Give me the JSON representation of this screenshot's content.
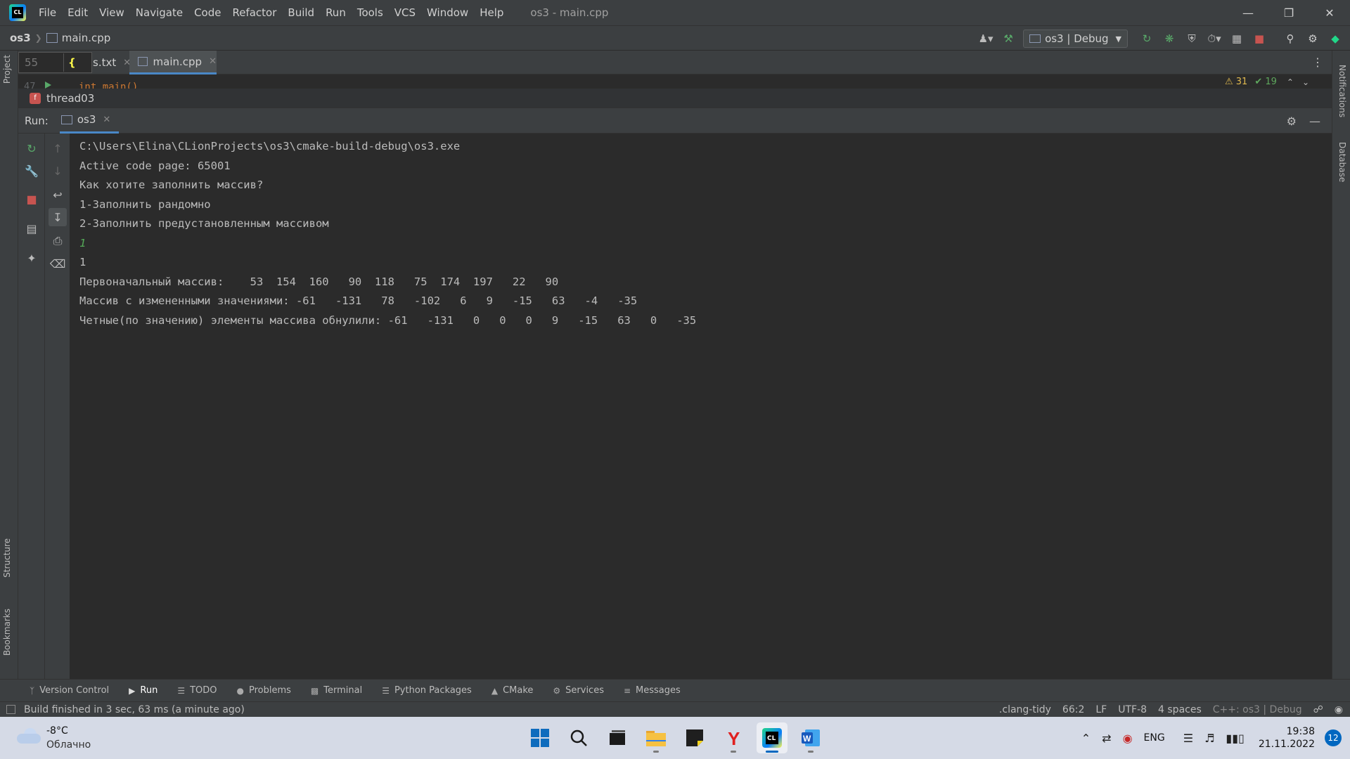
{
  "titlebar": {
    "menu": [
      "File",
      "Edit",
      "View",
      "Navigate",
      "Code",
      "Refactor",
      "Build",
      "Run",
      "Tools",
      "VCS",
      "Window",
      "Help"
    ],
    "title": "os3 - main.cpp",
    "logo_text": "CL"
  },
  "navbar": {
    "project": "os3",
    "file": "main.cpp",
    "run_config": "os3 | Debug"
  },
  "editor": {
    "goto_line_value": "55",
    "tabs": [
      {
        "label": "s.txt"
      },
      {
        "label": "main.cpp",
        "active": true
      }
    ],
    "visible_code_line_number": "47",
    "visible_code": "int main()",
    "warnings": "31",
    "weak_warnings": "19",
    "breadcrumb_function": "thread03"
  },
  "run_window": {
    "label": "Run:",
    "tab": "os3",
    "console_lines": [
      {
        "text": "C:\\Users\\Elina\\CLionProjects\\os3\\cmake-build-debug\\os3.exe",
        "input": false
      },
      {
        "text": "Active code page: 65001",
        "input": false
      },
      {
        "text": "Как хотите заполнить массив?",
        "input": false
      },
      {
        "text": "1-Заполнить рандомно",
        "input": false
      },
      {
        "text": "2-Заполнить предустановленным массивом",
        "input": false
      },
      {
        "text": "1",
        "input": true
      },
      {
        "text": "1",
        "input": false
      },
      {
        "text": "Первоначальный массив:    53  154  160   90  118   75  174  197   22   90",
        "input": false
      },
      {
        "text": "Массив с измененными значениями: -61   -131   78   -102   6   9   -15   63   -4   -35",
        "input": false
      },
      {
        "text": "Четные(по значению) элементы массива обнулили: -61   -131   0   0   0   9   -15   63   0   -35",
        "input": false
      }
    ]
  },
  "side_panels": {
    "left_top": "Project",
    "left_structure": "Structure",
    "left_bookmarks": "Bookmarks",
    "right_notifications": "Notifications",
    "right_database": "Database"
  },
  "bottom_tabs": [
    {
      "label": "Version Control",
      "icon": "branch-icon"
    },
    {
      "label": "Run",
      "icon": "play-icon",
      "active": true
    },
    {
      "label": "TODO",
      "icon": "list-icon"
    },
    {
      "label": "Problems",
      "icon": "info-icon"
    },
    {
      "label": "Terminal",
      "icon": "terminal-icon"
    },
    {
      "label": "Python Packages",
      "icon": "layers-icon"
    },
    {
      "label": "CMake",
      "icon": "triangle-icon"
    },
    {
      "label": "Services",
      "icon": "services-icon"
    },
    {
      "label": "Messages",
      "icon": "messages-icon"
    }
  ],
  "statusbar": {
    "message": "Build finished in 3 sec, 63 ms (a minute ago)",
    "clang_tidy": ".clang-tidy",
    "position": "66:2",
    "line_sep": "LF",
    "encoding": "UTF-8",
    "indent": "4 spaces",
    "context": "C++: os3 | Debug"
  },
  "taskbar": {
    "temperature": "-8°C",
    "weather": "Облачно",
    "language": "ENG",
    "time": "19:38",
    "date": "21.11.2022",
    "notifications": "12"
  },
  "colors": {
    "background": "#2b2b2b",
    "panel": "#3c3f41",
    "accent": "#4a88c7",
    "console_text": "#bbbbbb",
    "console_input": "#54a857",
    "taskbar": "#d5dae6"
  }
}
